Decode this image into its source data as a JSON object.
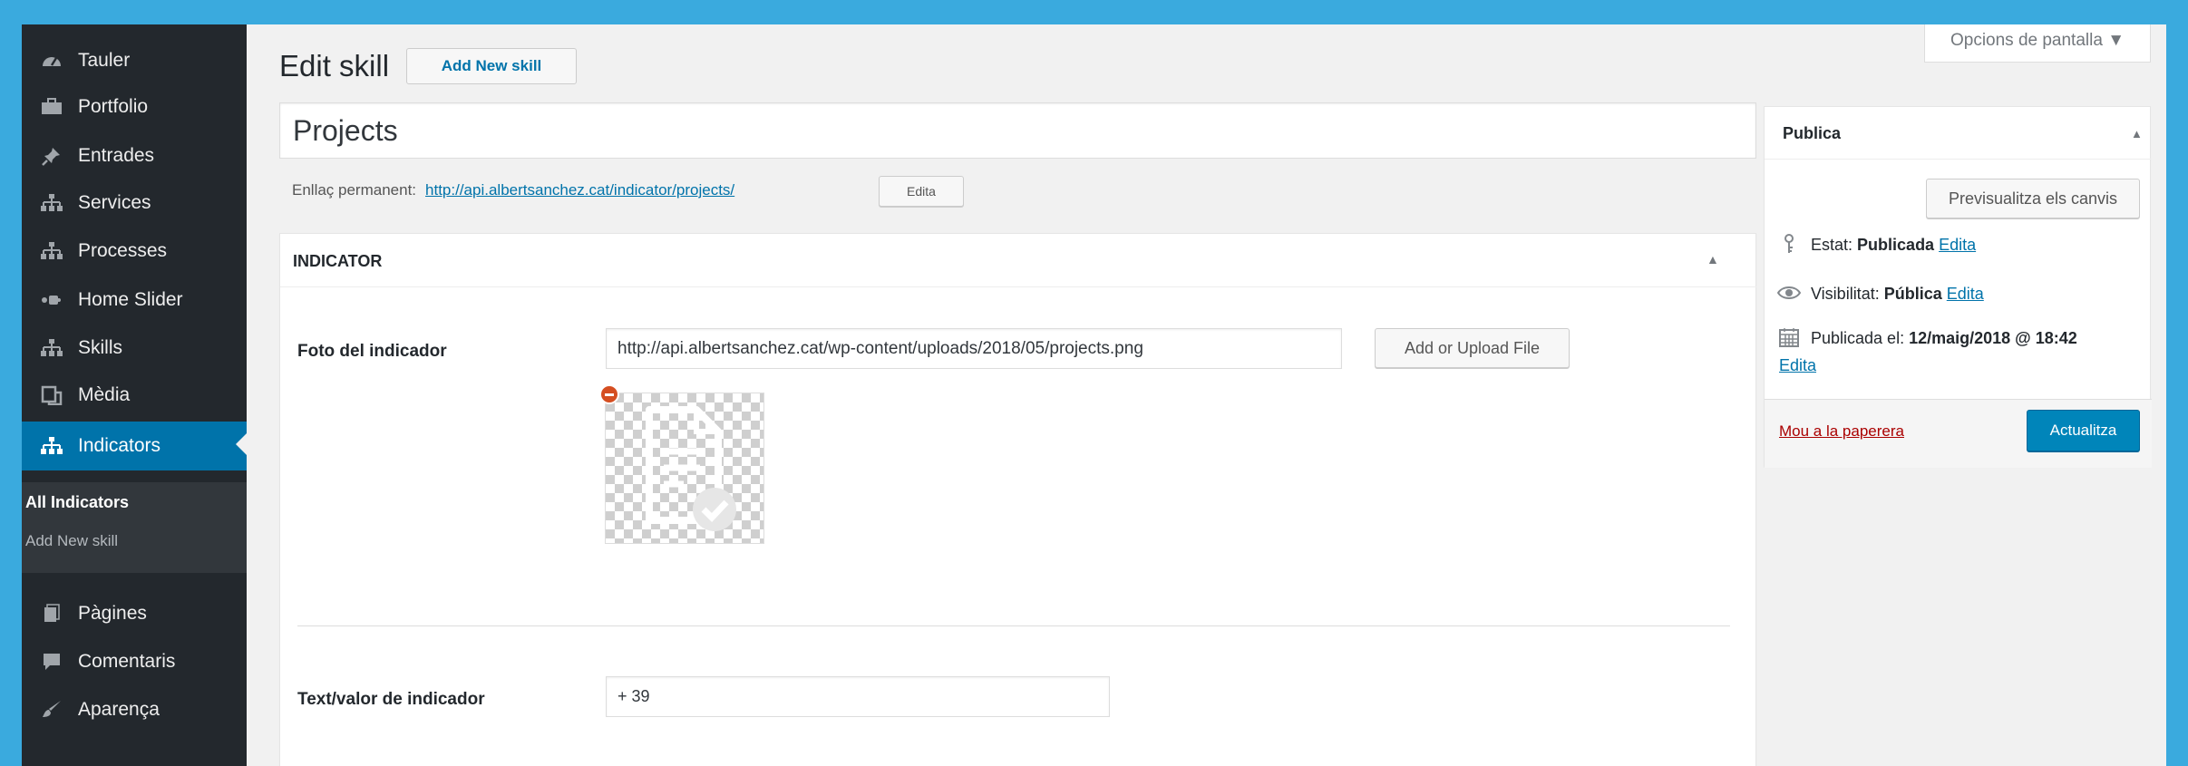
{
  "sidebar": {
    "items": [
      {
        "label": "Tauler",
        "icon": "dashboard-icon"
      },
      {
        "label": "Portfolio",
        "icon": "portfolio-icon"
      },
      {
        "label": "Entrades",
        "icon": "pin-icon"
      },
      {
        "label": "Services",
        "icon": "hierarchy-icon"
      },
      {
        "label": "Processes",
        "icon": "hierarchy-icon"
      },
      {
        "label": "Home Slider",
        "icon": "slider-icon"
      },
      {
        "label": "Skills",
        "icon": "hierarchy-icon"
      },
      {
        "label": "Mèdia",
        "icon": "media-icon"
      },
      {
        "label": "Indicators",
        "icon": "hierarchy-icon"
      },
      {
        "label": "Pàgines",
        "icon": "page-icon"
      },
      {
        "label": "Comentaris",
        "icon": "comment-icon"
      },
      {
        "label": "Aparença",
        "icon": "brush-icon"
      }
    ],
    "submenu": [
      {
        "label": "All Indicators"
      },
      {
        "label": "Add New skill"
      }
    ]
  },
  "header": {
    "screen_options": "Opcions de pantalla ▼",
    "title": "Edit skill",
    "add_new": "Add New skill"
  },
  "post": {
    "title_value": "Projects",
    "permalink_label": "Enllaç permanent:",
    "permalink_url": "http://api.albertsanchez.cat/indicator/projects/",
    "permalink_edit": "Edita"
  },
  "indicator_box": {
    "heading": "INDICATOR",
    "photo_label": "Foto del indicador",
    "photo_url": "http://api.albertsanchez.cat/wp-content/uploads/2018/05/projects.png",
    "upload_button": "Add or Upload File",
    "text_label": "Text/valor de indicador",
    "text_value": "+ 39"
  },
  "publish_box": {
    "heading": "Publica",
    "preview_button": "Previsualitza els canvis",
    "status_label": "Estat:",
    "status_value": "Publicada",
    "visibility_label": "Visibilitat:",
    "visibility_value": "Pública",
    "published_label": "Publicada el:",
    "published_value": "12/maig/2018 @ 18:42",
    "edit_link": "Edita",
    "trash_link": "Mou a la paperera",
    "update_button": "Actualitza"
  },
  "colors": {
    "outer_background": "#3aaade",
    "admin_menu": "#23282d",
    "submenu": "#32373c",
    "accent": "#0073aa",
    "trash": "#a00"
  }
}
